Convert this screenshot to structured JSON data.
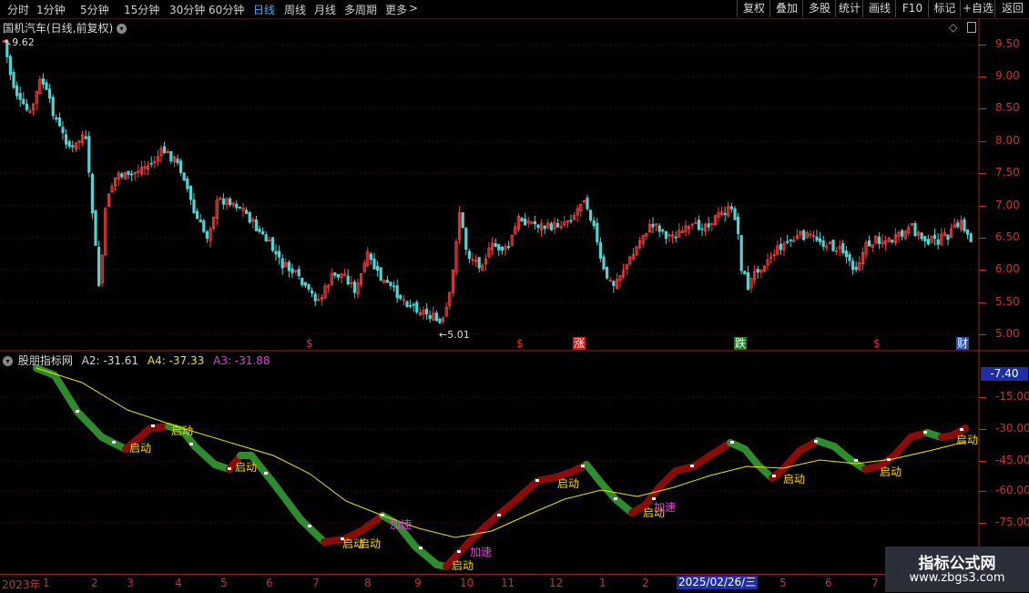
{
  "toolbar": {
    "periods": [
      {
        "label": "分时"
      },
      {
        "label": "1分钟"
      },
      {
        "label": "5分钟"
      },
      {
        "label": "15分钟"
      },
      {
        "label": "30分钟"
      },
      {
        "label": "60分钟"
      },
      {
        "label": "日线"
      },
      {
        "label": "周线"
      },
      {
        "label": "月线"
      },
      {
        "label": "多周期"
      },
      {
        "label": "更多"
      }
    ],
    "active_period": "日线",
    "more_arrow": ">",
    "buttons": [
      {
        "label": "复权"
      },
      {
        "label": "叠加"
      },
      {
        "label": "多股"
      },
      {
        "label": "统计"
      },
      {
        "label": "画线"
      },
      {
        "label": "F10"
      },
      {
        "label": "标记"
      },
      {
        "label": "+自选"
      },
      {
        "label": "返回"
      }
    ]
  },
  "main_chart": {
    "title": "国机汽车(日线,前复权)",
    "high_label": "9.62",
    "low_label": "5.01",
    "y_ticks": [
      "9.50",
      "9.00",
      "8.50",
      "8.00",
      "7.50",
      "7.00",
      "6.50",
      "6.00",
      "5.50",
      "5.00"
    ],
    "event_markers": [
      {
        "label": "$",
        "color": "#e03030"
      },
      {
        "label": "$",
        "color": "#e03030"
      },
      {
        "label": "涨",
        "color": "#ffffff",
        "bg": "#c02020"
      },
      {
        "label": "跌",
        "color": "#ffffff",
        "bg": "#208020"
      },
      {
        "label": "$",
        "color": "#e03030"
      },
      {
        "label": "财",
        "color": "#ffffff",
        "bg": "#2050c0"
      }
    ]
  },
  "indicator": {
    "name": "股朋指标网",
    "a2_label": "A2: -31.61",
    "a4_label": "A4: -37.33",
    "a3_label": "A3: -31.88",
    "current_value": "-7.40",
    "y_ticks": [
      "-15.00",
      "-30.00",
      "-45.00",
      "-60.00",
      "-75.00"
    ],
    "signal_labels": [
      "启动",
      "启动",
      "启动",
      "启动",
      "启动",
      "加速",
      "启动",
      "加速",
      "启动",
      "启动",
      "加速",
      "启动",
      "启动",
      "启动"
    ]
  },
  "x_axis": {
    "labels": [
      "2023年",
      "1",
      "2",
      "3",
      "4",
      "5",
      "6",
      "7",
      "8",
      "9",
      "10",
      "11",
      "12",
      "1",
      "2",
      "5",
      "6",
      "7"
    ],
    "cursor_date": "2025/02/26/三"
  },
  "watermark": {
    "line1": "指标公式网",
    "line2": "www.zbgs3.com"
  },
  "colors": {
    "up": "#ff4040",
    "down": "#54d2d2",
    "ma": "#e6e600",
    "bull": "#8b0a0a",
    "bear": "#2e8b2e",
    "signal": "#ffd700",
    "accel": "#e040e0"
  }
}
